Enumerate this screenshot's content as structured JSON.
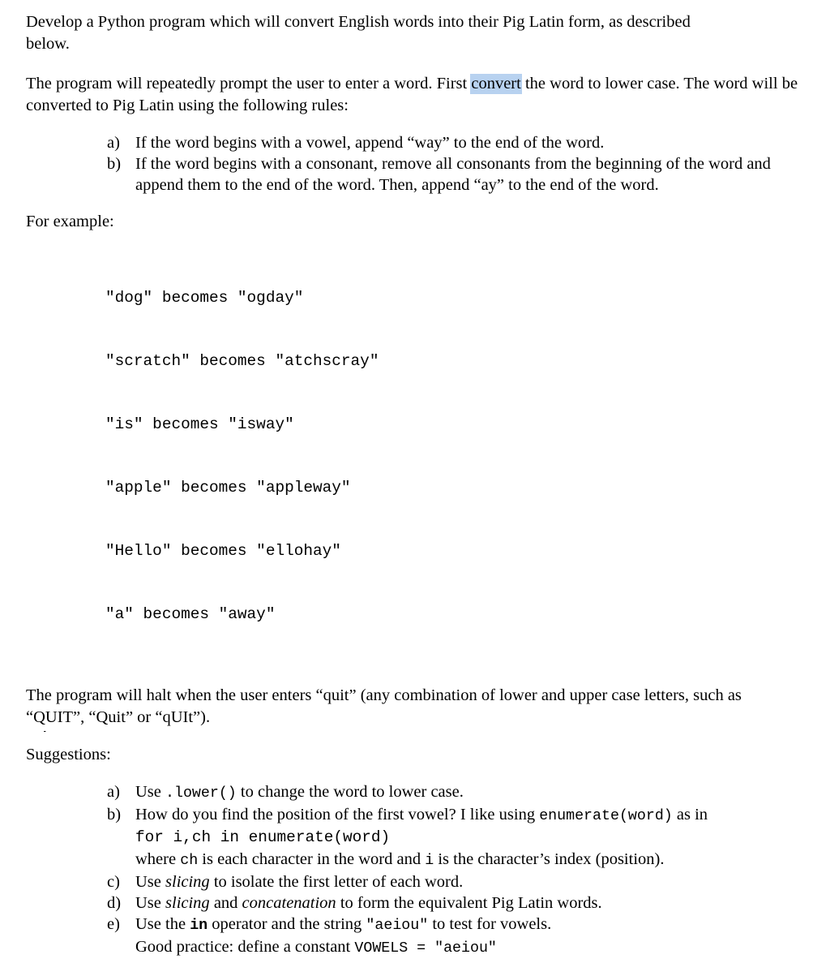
{
  "document": {
    "intro": {
      "line1": "Develop a Python program which will convert English words into their Pig Latin form, as described",
      "line2": "below."
    },
    "prompt_paragraph": {
      "before_selection": "The program will repeatedly prompt the user to enter a word.  First ",
      "selected_word": "convert",
      "after_selection": " the word to lower case. The word will be converted to Pig Latin using the following rules:"
    },
    "rules_list": [
      {
        "marker": "a)",
        "text": "If the word begins with a vowel, append “way” to the end of the word."
      },
      {
        "marker": "b)",
        "text": "If the word begins with a consonant, remove all consonants from the beginning of the word and append them to the end of the word.  Then, append “ay” to the end of the word."
      }
    ],
    "example_heading": "For example:",
    "example_lines": [
      "\"dog\" becomes \"ogday\"",
      "\"scratch\" becomes \"atchscray\"",
      "\"is\" becomes \"isway\"",
      "\"apple\" becomes \"appleway\"",
      "\"Hello\" becomes \"ellohay\"",
      "\"a\" becomes \"away\""
    ],
    "halt_paragraph": "The program will halt when the user enters “quit” (any combination of lower and upper case letters, such as “QUIT”, “Quit” or “qUIt”).",
    "suggestions_heading": "Suggestions:",
    "suggestions": {
      "a": {
        "marker": "a)",
        "part1": "Use ",
        "code1": ".lower()",
        "part2": " to change the word to lower case."
      },
      "b": {
        "marker": "b)",
        "part1": "How do you find the position of the first vowel?  I like using ",
        "code1": "enumerate(word)",
        "part2": " as in",
        "code_line": "for i,ch in enumerate(word)",
        "part3": "where ",
        "code2": "ch",
        "part4": " is each character in the word and ",
        "code3": "i",
        "part5": " is the character’s index (position)."
      },
      "c": {
        "marker": "c)",
        "part1": "Use ",
        "italic1": "slicing",
        "part2": " to isolate the first letter of each word."
      },
      "d": {
        "marker": "d)",
        "part1": "Use ",
        "italic1": "slicing",
        "part2": " and ",
        "italic2": "concatenation",
        "part3": " to form the equivalent Pig Latin words."
      },
      "e": {
        "marker": "e)",
        "part1": "Use the ",
        "code_bold": "in",
        "part2": " operator and the string ",
        "code1": "\"aeiou\"",
        "part3": "  to test for vowels.",
        "note_part1": "Good practice: define a constant ",
        "note_code": "VOWELS = \"aeiou\""
      }
    },
    "clipped_fragment": "A"
  },
  "colors": {
    "page_background": "#ffffff",
    "text": "#000000",
    "selection_highlight": "#b8d2f0"
  }
}
